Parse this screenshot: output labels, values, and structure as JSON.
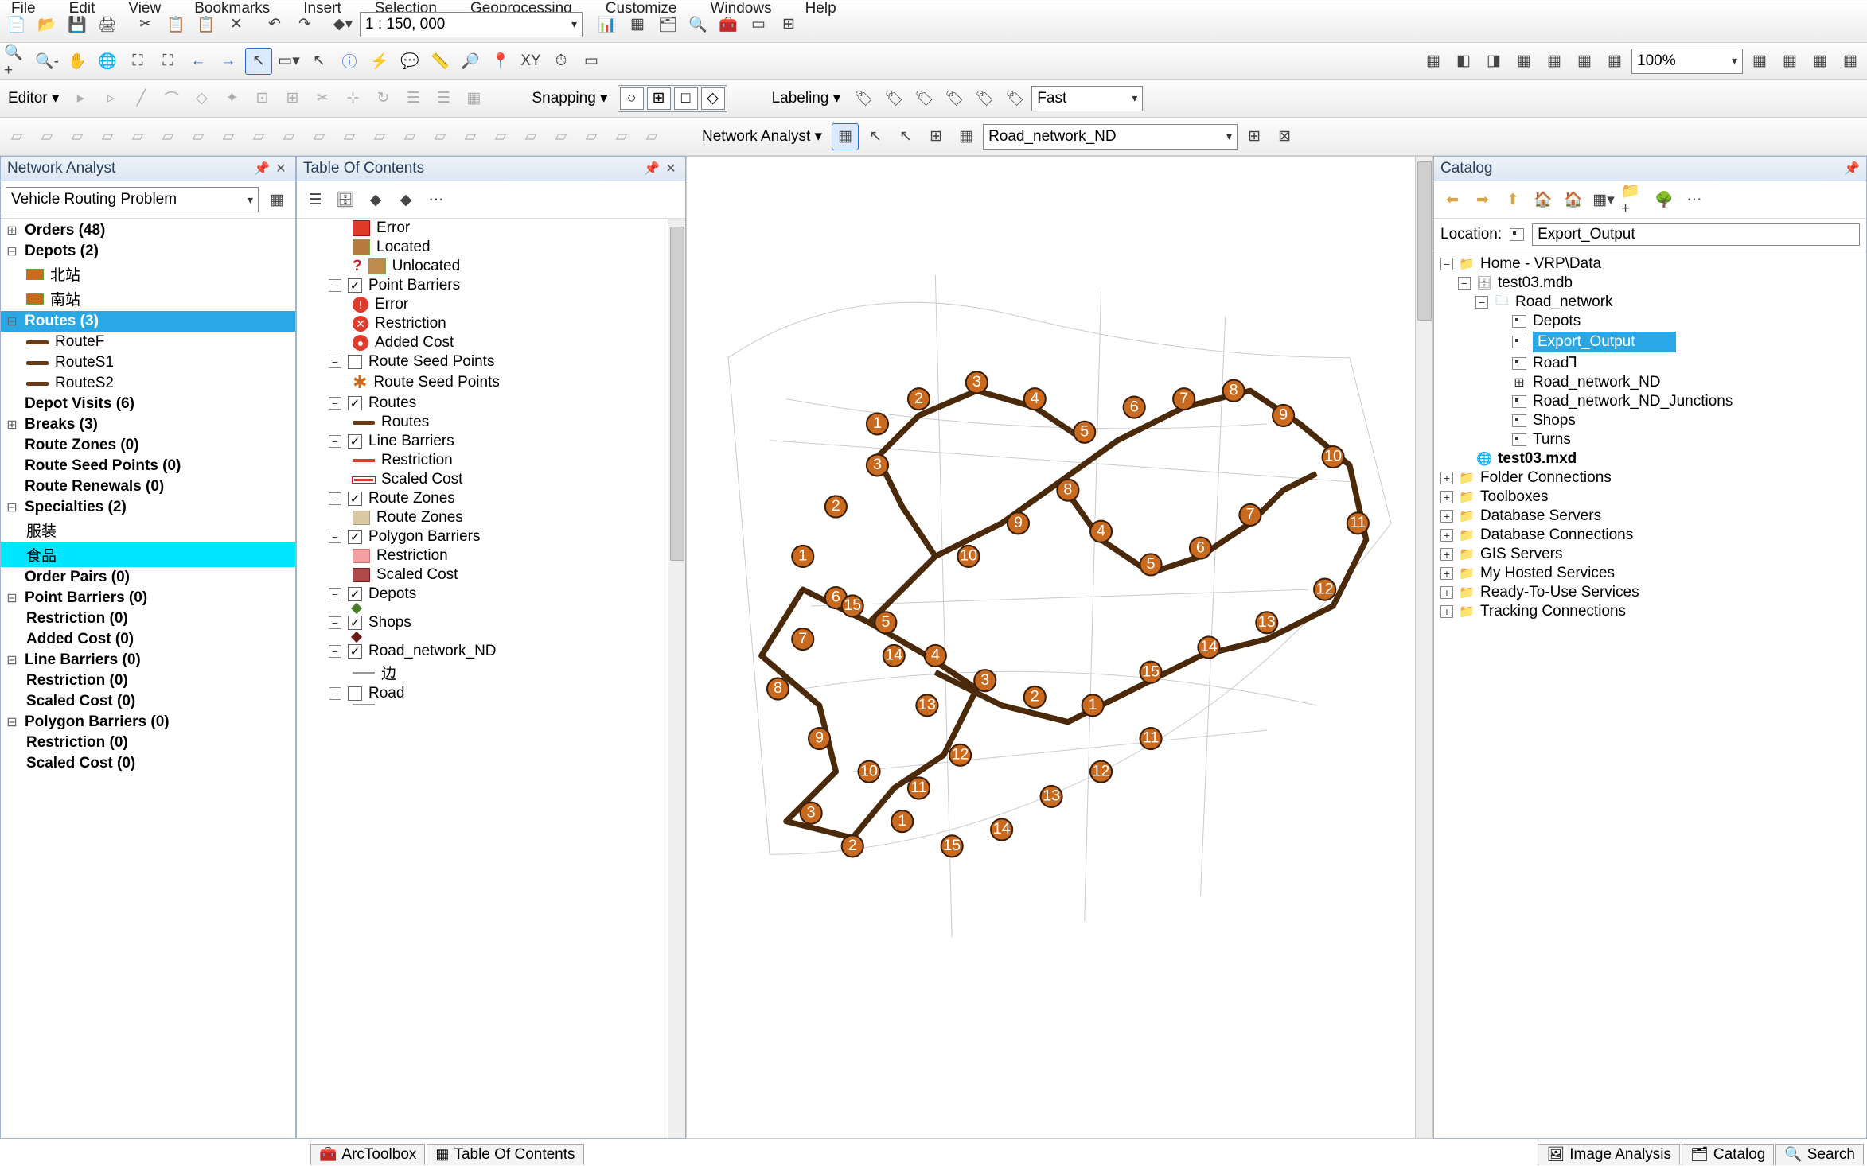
{
  "menu": {
    "file": "File",
    "edit": "Edit",
    "view": "View",
    "bookmarks": "Bookmarks",
    "insert": "Insert",
    "selection": "Selection",
    "geoprocessing": "Geoprocessing",
    "customize": "Customize",
    "windows": "Windows",
    "help": "Help"
  },
  "toolbar": {
    "scale": "1 : 150, 000",
    "zoom_pct": "100%",
    "editor_label": "Editor",
    "snapping_label": "Snapping",
    "labeling_label": "Labeling",
    "fast_label": "Fast",
    "na_label": "Network Analyst",
    "nd_combo": "Road_network_ND"
  },
  "na_panel": {
    "title": "Network Analyst",
    "solver": "Vehicle Routing Problem",
    "items": [
      {
        "lvl": 1,
        "exp": "+",
        "bold": true,
        "label": "Orders (48)"
      },
      {
        "lvl": 1,
        "exp": "-",
        "bold": true,
        "label": "Depots (2)"
      },
      {
        "lvl": 2,
        "sym": "sq",
        "label": "北站"
      },
      {
        "lvl": 2,
        "sym": "sq",
        "label": "南站"
      },
      {
        "lvl": 1,
        "exp": "-",
        "bold": true,
        "label": "Routes (3)",
        "sel": "blue"
      },
      {
        "lvl": 2,
        "sym": "line",
        "label": "RouteF"
      },
      {
        "lvl": 2,
        "sym": "line",
        "label": "RouteS1"
      },
      {
        "lvl": 2,
        "sym": "line",
        "label": "RouteS2"
      },
      {
        "lvl": 1,
        "exp": "",
        "bold": true,
        "label": "Depot Visits (6)"
      },
      {
        "lvl": 1,
        "exp": "+",
        "bold": true,
        "label": "Breaks (3)"
      },
      {
        "lvl": 1,
        "exp": "",
        "bold": true,
        "label": "Route Zones (0)"
      },
      {
        "lvl": 1,
        "exp": "",
        "bold": true,
        "label": "Route Seed Points (0)"
      },
      {
        "lvl": 1,
        "exp": "",
        "bold": true,
        "label": "Route Renewals (0)"
      },
      {
        "lvl": 1,
        "exp": "-",
        "bold": true,
        "label": "Specialties (2)"
      },
      {
        "lvl": 2,
        "label": "服装"
      },
      {
        "lvl": 2,
        "label": "食品",
        "sel": "cyan"
      },
      {
        "lvl": 1,
        "exp": "",
        "bold": true,
        "label": "Order Pairs (0)"
      },
      {
        "lvl": 1,
        "exp": "-",
        "bold": true,
        "label": "Point Barriers (0)"
      },
      {
        "lvl": 2,
        "bold": true,
        "label": "Restriction (0)"
      },
      {
        "lvl": 2,
        "bold": true,
        "label": "Added Cost (0)"
      },
      {
        "lvl": 1,
        "exp": "-",
        "bold": true,
        "label": "Line Barriers (0)"
      },
      {
        "lvl": 2,
        "bold": true,
        "label": "Restriction (0)"
      },
      {
        "lvl": 2,
        "bold": true,
        "label": "Scaled Cost (0)"
      },
      {
        "lvl": 1,
        "exp": "-",
        "bold": true,
        "label": "Polygon Barriers (0)"
      },
      {
        "lvl": 2,
        "bold": true,
        "label": "Restriction (0)"
      },
      {
        "lvl": 2,
        "bold": true,
        "label": "Scaled Cost (0)"
      }
    ]
  },
  "toc_panel": {
    "title": "Table Of Contents",
    "items": [
      {
        "lvl": 2,
        "sym": "red-sq",
        "label": "Error"
      },
      {
        "lvl": 2,
        "sym": "brown-sq",
        "label": "Located"
      },
      {
        "lvl": 2,
        "sym": "q",
        "label": "Unlocated",
        "pre": "?"
      },
      {
        "lvl": 1,
        "exp": "-",
        "cb": true,
        "label": "Point Barriers"
      },
      {
        "lvl": 2,
        "sym": "red-c",
        "label": "Error",
        "glyph": "!"
      },
      {
        "lvl": 2,
        "sym": "red-c",
        "label": "Restriction",
        "glyph": "✕"
      },
      {
        "lvl": 2,
        "sym": "red-c",
        "label": "Added Cost",
        "glyph": "●"
      },
      {
        "lvl": 1,
        "exp": "-",
        "cb": false,
        "label": "Route Seed Points"
      },
      {
        "lvl": 2,
        "sym": "star",
        "label": "Route Seed Points"
      },
      {
        "lvl": 1,
        "exp": "-",
        "cb": true,
        "label": "Routes"
      },
      {
        "lvl": 2,
        "sym": "line",
        "label": "Routes"
      },
      {
        "lvl": 1,
        "exp": "-",
        "cb": true,
        "label": "Line Barriers"
      },
      {
        "lvl": 2,
        "sym": "redline",
        "label": "Restriction"
      },
      {
        "lvl": 2,
        "sym": "dashred",
        "label": "Scaled Cost"
      },
      {
        "lvl": 1,
        "exp": "-",
        "cb": true,
        "label": "Route Zones"
      },
      {
        "lvl": 2,
        "sym": "tan",
        "label": "Route Zones"
      },
      {
        "lvl": 1,
        "exp": "-",
        "cb": true,
        "label": "Polygon Barriers"
      },
      {
        "lvl": 2,
        "sym": "pink",
        "label": "Restriction"
      },
      {
        "lvl": 2,
        "sym": "maroon",
        "label": "Scaled Cost"
      },
      {
        "lvl": 1,
        "exp": "-",
        "cb": true,
        "label": "Depots"
      },
      {
        "lvl": 2,
        "sym": "dia-g",
        "label": ""
      },
      {
        "lvl": 1,
        "exp": "-",
        "cb": true,
        "label": "Shops"
      },
      {
        "lvl": 2,
        "sym": "dia-d",
        "label": ""
      },
      {
        "lvl": 1,
        "exp": "-",
        "cb": true,
        "label": "Road_network_ND"
      },
      {
        "lvl": 2,
        "sym": "gray",
        "label": "边"
      },
      {
        "lvl": 1,
        "exp": "-",
        "cb": false,
        "label": "Road"
      },
      {
        "lvl": 2,
        "sym": "gray",
        "label": ""
      }
    ]
  },
  "catalog": {
    "title": "Catalog",
    "location_label": "Location:",
    "location_value": "Export_Output",
    "tree": [
      {
        "lvl": 0,
        "exp": "-",
        "ico": "folder",
        "label": "Home - VRP\\Data"
      },
      {
        "lvl": 1,
        "exp": "-",
        "ico": "db",
        "label": "test03.mdb"
      },
      {
        "lvl": 2,
        "exp": "-",
        "ico": "fds",
        "label": "Road_network"
      },
      {
        "lvl": 3,
        "ico": "fc",
        "label": "Depots"
      },
      {
        "lvl": 3,
        "ico": "fc",
        "label": "Export_Output",
        "rename": true
      },
      {
        "lvl": 3,
        "ico": "fc",
        "label": "Road",
        "cursor": true
      },
      {
        "lvl": 3,
        "ico": "nd",
        "label": "Road_network_ND"
      },
      {
        "lvl": 3,
        "ico": "fc",
        "label": "Road_network_ND_Junctions"
      },
      {
        "lvl": 3,
        "ico": "fc",
        "label": "Shops"
      },
      {
        "lvl": 3,
        "ico": "fc",
        "label": "Turns"
      },
      {
        "lvl": 1,
        "ico": "mxd",
        "bold": true,
        "label": "test03.mxd"
      },
      {
        "lvl": 0,
        "exp": "+",
        "ico": "folder",
        "label": "Folder Connections"
      },
      {
        "lvl": 0,
        "exp": "+",
        "ico": "folder",
        "label": "Toolboxes"
      },
      {
        "lvl": 0,
        "exp": "+",
        "ico": "folder",
        "label": "Database Servers"
      },
      {
        "lvl": 0,
        "exp": "+",
        "ico": "folder",
        "label": "Database Connections"
      },
      {
        "lvl": 0,
        "exp": "+",
        "ico": "folder",
        "label": "GIS Servers"
      },
      {
        "lvl": 0,
        "exp": "+",
        "ico": "folder",
        "label": "My Hosted Services"
      },
      {
        "lvl": 0,
        "exp": "+",
        "ico": "folder",
        "label": "Ready-To-Use Services"
      },
      {
        "lvl": 0,
        "exp": "+",
        "ico": "folder",
        "label": "Tracking Connections"
      }
    ]
  },
  "bottom": {
    "arctoolbox": "ArcToolbox",
    "toc": "Table Of Contents",
    "image_analysis": "Image Analysis",
    "catalog": "Catalog",
    "search": "Search"
  }
}
